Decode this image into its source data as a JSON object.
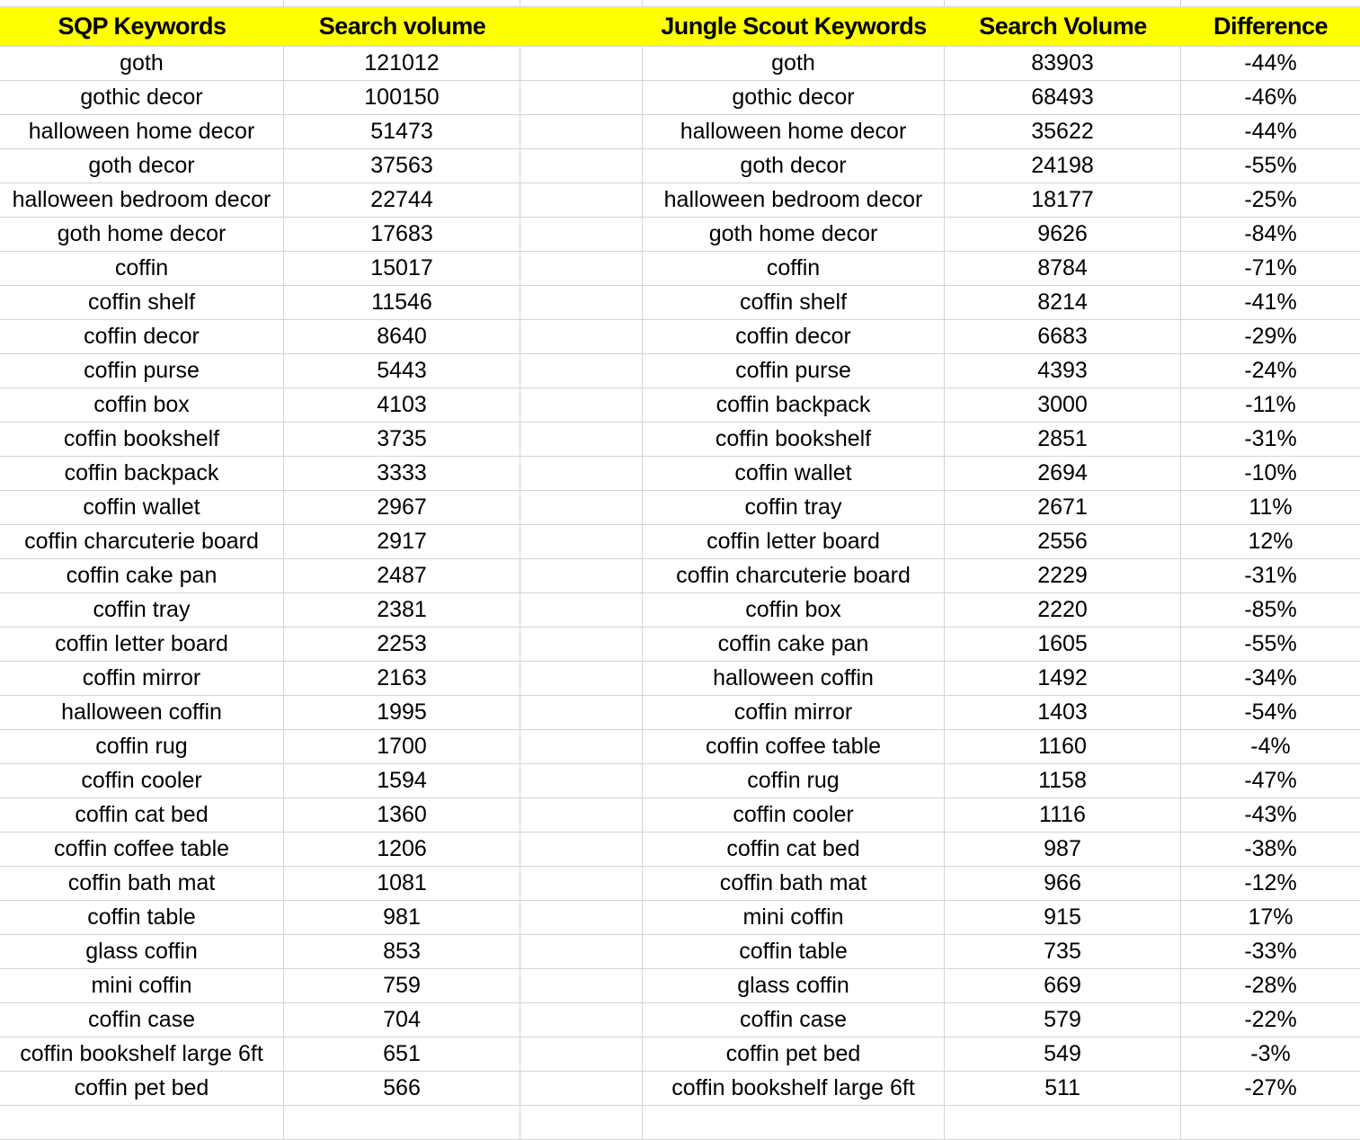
{
  "headers": {
    "sqp_keywords": "SQP Keywords",
    "sqp_search_volume": "Search volume",
    "blank": "",
    "js_keywords": "Jungle Scout Keywords",
    "js_search_volume": "Search Volume",
    "difference": "Difference"
  },
  "colors": {
    "header_bg": "#ffff00",
    "gridline": "#d4d4d4"
  },
  "rows": [
    {
      "sqp": "goth",
      "sqp_vol": "121012",
      "js": "goth",
      "js_vol": "83903",
      "diff": "-44%"
    },
    {
      "sqp": "gothic decor",
      "sqp_vol": "100150",
      "js": "gothic decor",
      "js_vol": "68493",
      "diff": "-46%"
    },
    {
      "sqp": "halloween home decor",
      "sqp_vol": "51473",
      "js": "halloween home decor",
      "js_vol": "35622",
      "diff": "-44%"
    },
    {
      "sqp": "goth decor",
      "sqp_vol": "37563",
      "js": "goth decor",
      "js_vol": "24198",
      "diff": "-55%"
    },
    {
      "sqp": "halloween bedroom decor",
      "sqp_vol": "22744",
      "js": "halloween bedroom decor",
      "js_vol": "18177",
      "diff": "-25%"
    },
    {
      "sqp": "goth home decor",
      "sqp_vol": "17683",
      "js": "goth home decor",
      "js_vol": "9626",
      "diff": "-84%"
    },
    {
      "sqp": "coffin",
      "sqp_vol": "15017",
      "js": "coffin",
      "js_vol": "8784",
      "diff": "-71%"
    },
    {
      "sqp": "coffin shelf",
      "sqp_vol": "11546",
      "js": "coffin shelf",
      "js_vol": "8214",
      "diff": "-41%"
    },
    {
      "sqp": "coffin decor",
      "sqp_vol": "8640",
      "js": "coffin decor",
      "js_vol": "6683",
      "diff": "-29%"
    },
    {
      "sqp": "coffin purse",
      "sqp_vol": "5443",
      "js": "coffin purse",
      "js_vol": "4393",
      "diff": "-24%"
    },
    {
      "sqp": "coffin box",
      "sqp_vol": "4103",
      "js": "coffin backpack",
      "js_vol": "3000",
      "diff": "-11%"
    },
    {
      "sqp": "coffin bookshelf",
      "sqp_vol": "3735",
      "js": "coffin bookshelf",
      "js_vol": "2851",
      "diff": "-31%"
    },
    {
      "sqp": "coffin backpack",
      "sqp_vol": "3333",
      "js": "coffin wallet",
      "js_vol": "2694",
      "diff": "-10%"
    },
    {
      "sqp": "coffin wallet",
      "sqp_vol": "2967",
      "js": "coffin tray",
      "js_vol": "2671",
      "diff": "11%"
    },
    {
      "sqp": "coffin charcuterie board",
      "sqp_vol": "2917",
      "js": "coffin letter board",
      "js_vol": "2556",
      "diff": "12%"
    },
    {
      "sqp": "coffin cake pan",
      "sqp_vol": "2487",
      "js": "coffin charcuterie board",
      "js_vol": "2229",
      "diff": "-31%"
    },
    {
      "sqp": "coffin tray",
      "sqp_vol": "2381",
      "js": "coffin box",
      "js_vol": "2220",
      "diff": "-85%"
    },
    {
      "sqp": "coffin letter board",
      "sqp_vol": "2253",
      "js": "coffin cake pan",
      "js_vol": "1605",
      "diff": "-55%"
    },
    {
      "sqp": "coffin mirror",
      "sqp_vol": "2163",
      "js": "halloween coffin",
      "js_vol": "1492",
      "diff": "-34%"
    },
    {
      "sqp": "halloween coffin",
      "sqp_vol": "1995",
      "js": "coffin mirror",
      "js_vol": "1403",
      "diff": "-54%"
    },
    {
      "sqp": "coffin rug",
      "sqp_vol": "1700",
      "js": "coffin coffee table",
      "js_vol": "1160",
      "diff": "-4%"
    },
    {
      "sqp": "coffin cooler",
      "sqp_vol": "1594",
      "js": "coffin rug",
      "js_vol": "1158",
      "diff": "-47%"
    },
    {
      "sqp": "coffin cat bed",
      "sqp_vol": "1360",
      "js": "coffin cooler",
      "js_vol": "1116",
      "diff": "-43%"
    },
    {
      "sqp": "coffin coffee table",
      "sqp_vol": "1206",
      "js": "coffin cat bed",
      "js_vol": "987",
      "diff": "-38%"
    },
    {
      "sqp": "coffin bath mat",
      "sqp_vol": "1081",
      "js": "coffin bath mat",
      "js_vol": "966",
      "diff": "-12%"
    },
    {
      "sqp": "coffin table",
      "sqp_vol": "981",
      "js": "mini coffin",
      "js_vol": "915",
      "diff": "17%"
    },
    {
      "sqp": "glass coffin",
      "sqp_vol": "853",
      "js": "coffin table",
      "js_vol": "735",
      "diff": "-33%"
    },
    {
      "sqp": "mini coffin",
      "sqp_vol": "759",
      "js": "glass coffin",
      "js_vol": "669",
      "diff": "-28%"
    },
    {
      "sqp": "coffin case",
      "sqp_vol": "704",
      "js": "coffin case",
      "js_vol": "579",
      "diff": "-22%"
    },
    {
      "sqp": "coffin bookshelf large 6ft",
      "sqp_vol": "651",
      "js": "coffin pet bed",
      "js_vol": "549",
      "diff": "-3%"
    },
    {
      "sqp": "coffin pet bed",
      "sqp_vol": "566",
      "js": "coffin bookshelf large 6ft",
      "js_vol": "511",
      "diff": "-27%"
    }
  ]
}
